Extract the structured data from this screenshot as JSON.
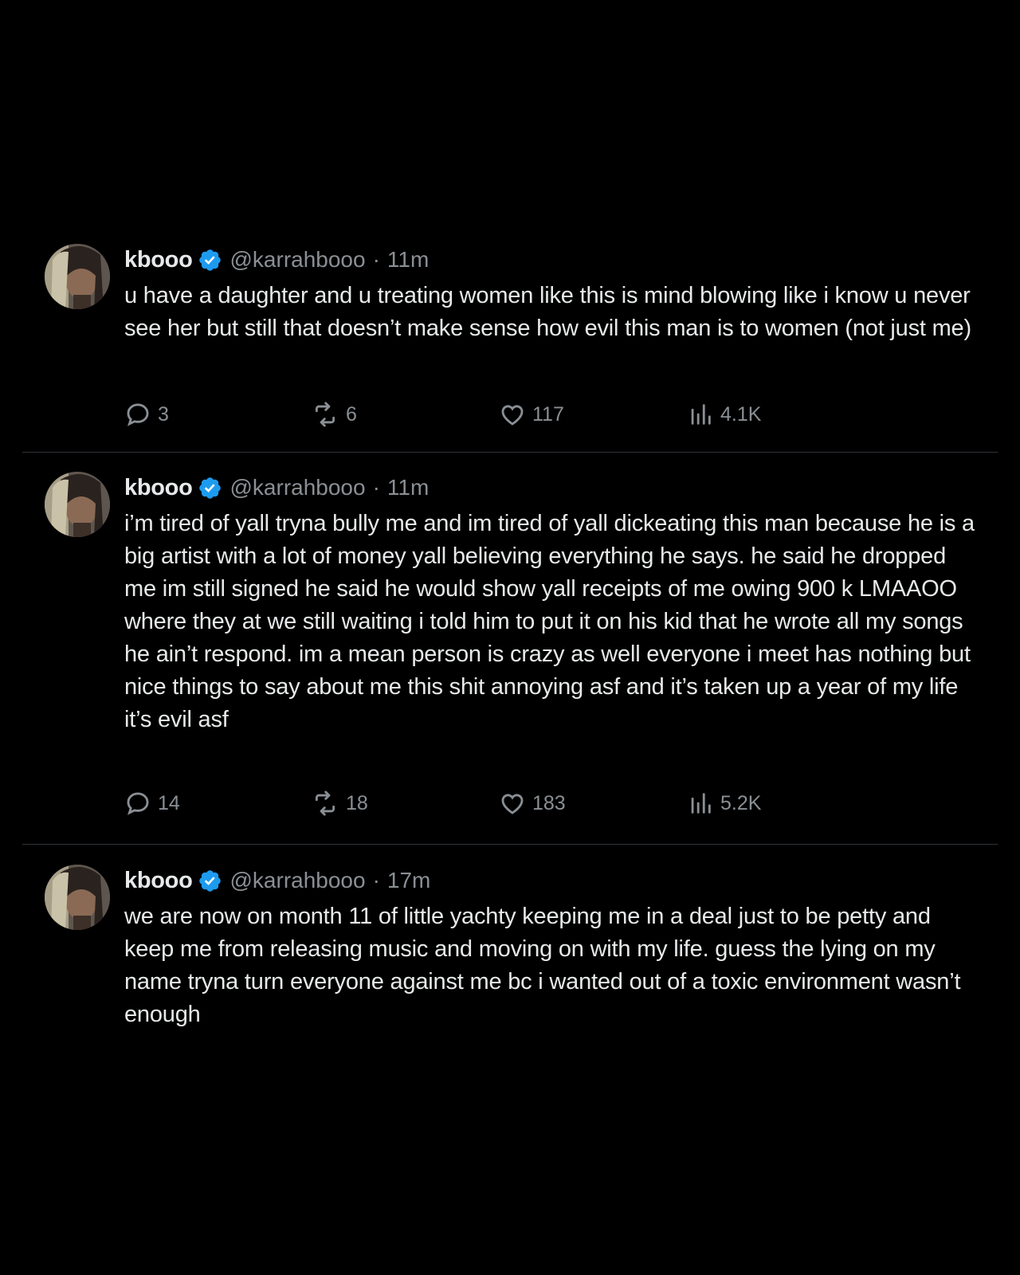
{
  "colors": {
    "background": "#000000",
    "text": "#e7e9ea",
    "secondary": "#8a8f94",
    "verified": "#1d9bf0",
    "divider": "#2f3336"
  },
  "tweets": [
    {
      "display_name": "kbooo",
      "handle": "@karrahbooo",
      "separator": "·",
      "time": "11m",
      "text": "u have a daughter and u treating women like this is mind blowing like i know u never see her but still that doesn’t make sense how evil this man is to women (not just me)",
      "replies": "3",
      "reposts": "6",
      "likes": "117",
      "views": "4.1K"
    },
    {
      "display_name": "kbooo",
      "handle": "@karrahbooo",
      "separator": "·",
      "time": "11m",
      "text": "i’m tired of yall tryna bully me and im tired of yall dickeating this man because he is a big artist with a lot of money yall believing everything he says. he said he dropped me im still signed he said he would show yall receipts of me owing 900 k LMAAOO where they at we still waiting i told him to put it on his kid that he wrote all my songs he ain’t respond. im a mean person is crazy as well everyone i meet has nothing but nice things to say about me this shit annoying asf and it’s taken up a year of my life it’s evil asf",
      "replies": "14",
      "reposts": "18",
      "likes": "183",
      "views": "5.2K"
    },
    {
      "display_name": "kbooo",
      "handle": "@karrahbooo",
      "separator": "·",
      "time": "17m",
      "text": "we are now on month 11 of little yachty keeping me in a deal just to be petty and keep me from releasing music and moving on with my life. guess the lying on my name tryna turn everyone against me bc i wanted out of a toxic environment wasn’t enough"
    }
  ]
}
